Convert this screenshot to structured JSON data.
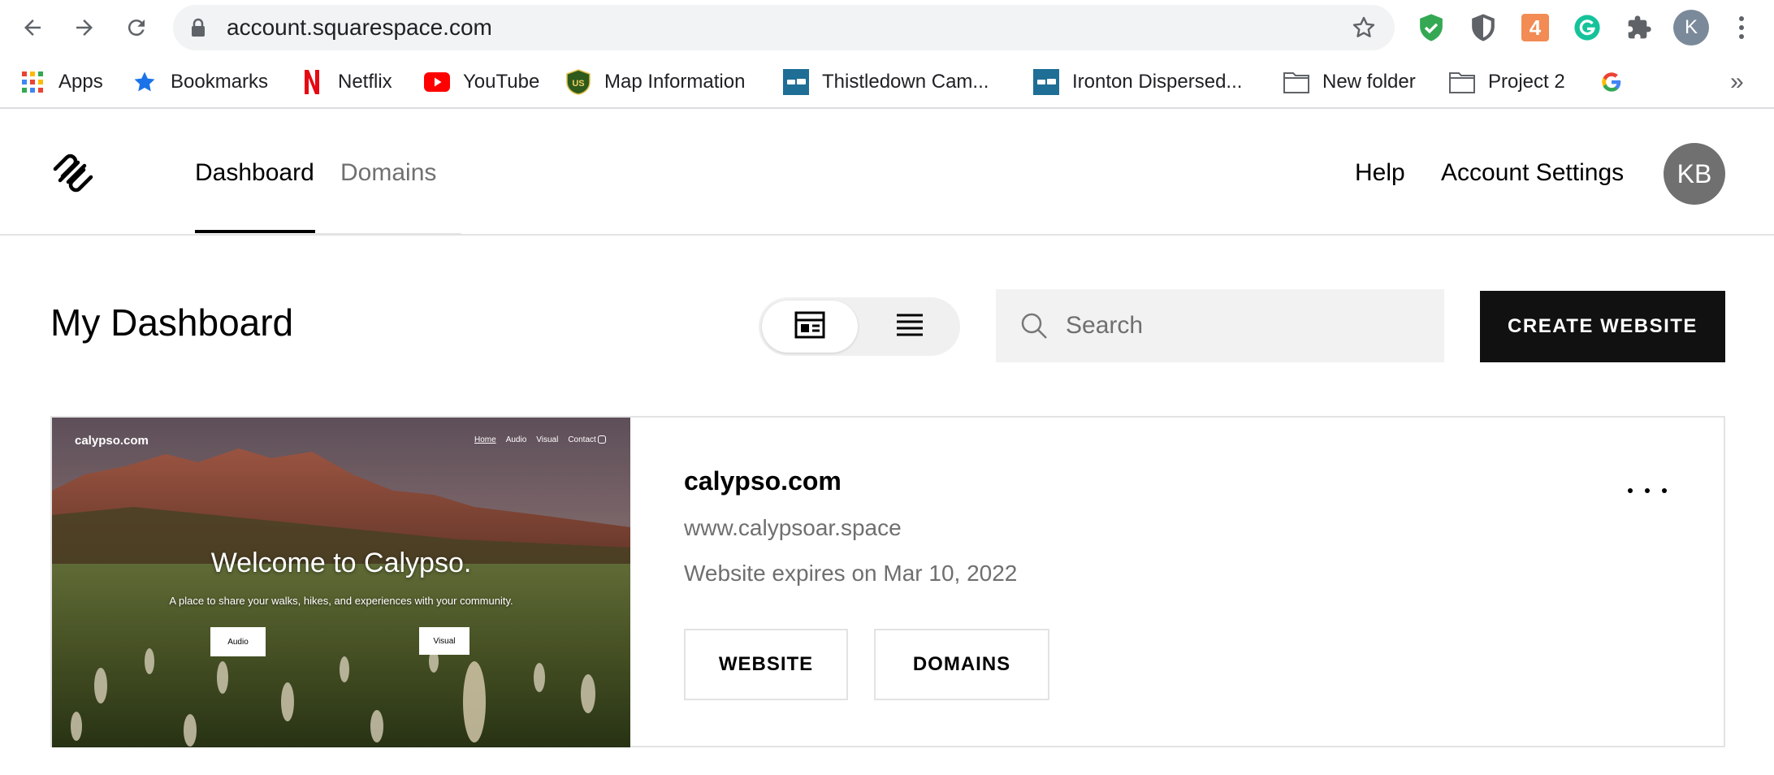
{
  "browser": {
    "url": "account.squarespace.com",
    "bookmarks": [
      {
        "label": "Apps",
        "icon": "apps-grid-icon"
      },
      {
        "label": "Bookmarks",
        "icon": "star-icon"
      },
      {
        "label": "Netflix",
        "icon": "netflix-icon"
      },
      {
        "label": "YouTube",
        "icon": "youtube-icon"
      },
      {
        "label": "Map Information",
        "icon": "forest-service-icon"
      },
      {
        "label": "Thistledown Cam...",
        "icon": "campground-icon"
      },
      {
        "label": "Ironton Dispersed...",
        "icon": "campground-icon"
      },
      {
        "label": "New folder",
        "icon": "folder-icon"
      },
      {
        "label": "Project 2",
        "icon": "folder-icon"
      },
      {
        "label": "",
        "icon": "google-icon"
      }
    ],
    "more": "»",
    "profile_initial": "K",
    "extension_number": "4"
  },
  "header": {
    "tabs": [
      {
        "label": "Dashboard",
        "active": true
      },
      {
        "label": "Domains",
        "active": false
      }
    ],
    "help": "Help",
    "account_settings": "Account Settings",
    "avatar_initials": "KB"
  },
  "dashboard": {
    "title": "My Dashboard",
    "search_placeholder": "Search",
    "create_button": "CREATE WEBSITE"
  },
  "site": {
    "name": "calypso.com",
    "url": "www.calypsoar.space",
    "expiry": "Website expires on Mar 10, 2022",
    "website_button": "WEBSITE",
    "domains_button": "DOMAINS",
    "preview": {
      "site_name": "calypso.com",
      "nav": [
        "Home",
        "Audio",
        "Visual",
        "Contact"
      ],
      "title": "Welcome to Calypso.",
      "subtitle": "A place to share your walks, hikes, and experiences with your community.",
      "buttons": [
        "Audio",
        "Visual"
      ]
    }
  },
  "colors": {
    "accent_black": "#111111",
    "muted_text": "#6f6f6f",
    "border": "#e3e3e3"
  }
}
